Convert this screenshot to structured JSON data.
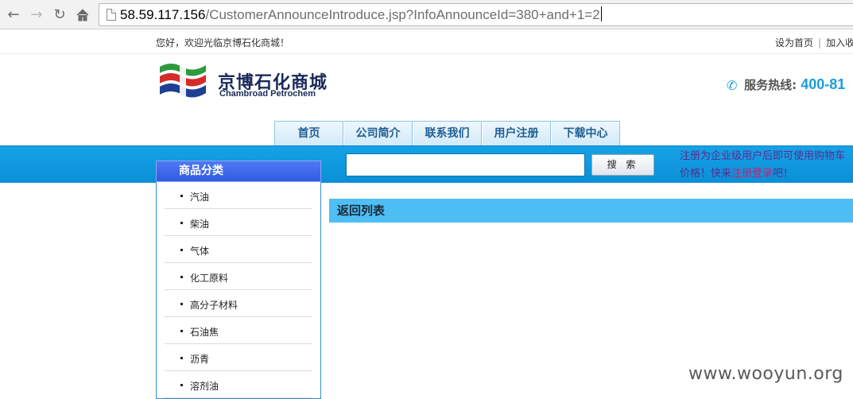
{
  "browser": {
    "url_host": "58.59.117.156",
    "url_path": "/CustomerAnnounceIntroduce.jsp?InfoAnnounceId=380+and+1=2"
  },
  "topbar": {
    "welcome": "您好，欢迎光临京博石化商城！",
    "links": [
      "设为首页",
      "加入收"
    ]
  },
  "header": {
    "brand_cn": "京博石化商城",
    "brand_en": "Chambroad Petrochem",
    "hotline_label": "服务热线:",
    "hotline_number": "400-81"
  },
  "nav": {
    "tabs": [
      "首页",
      "公司简介",
      "联系我们",
      "用户注册",
      "下载中心"
    ]
  },
  "search": {
    "placeholder": "",
    "button_label": "搜 索"
  },
  "promo": {
    "line1": "注册为企业级用户后即可使用购物车",
    "line2_prefix": "价格！快来",
    "line2_highlight": "注册登录",
    "line2_suffix": "吧！"
  },
  "sidebar": {
    "title": "商品分类",
    "items": [
      "汽油",
      "柴油",
      "气体",
      "化工原料",
      "高分子材料",
      "石油焦",
      "沥青",
      "溶剂油"
    ]
  },
  "content": {
    "back_label": "返回列表"
  },
  "watermark": "www.wooyun.org",
  "colors": {
    "band": "#0a8fd6",
    "content_head": "#4ebff4",
    "hotline": "#1a9ed8"
  }
}
